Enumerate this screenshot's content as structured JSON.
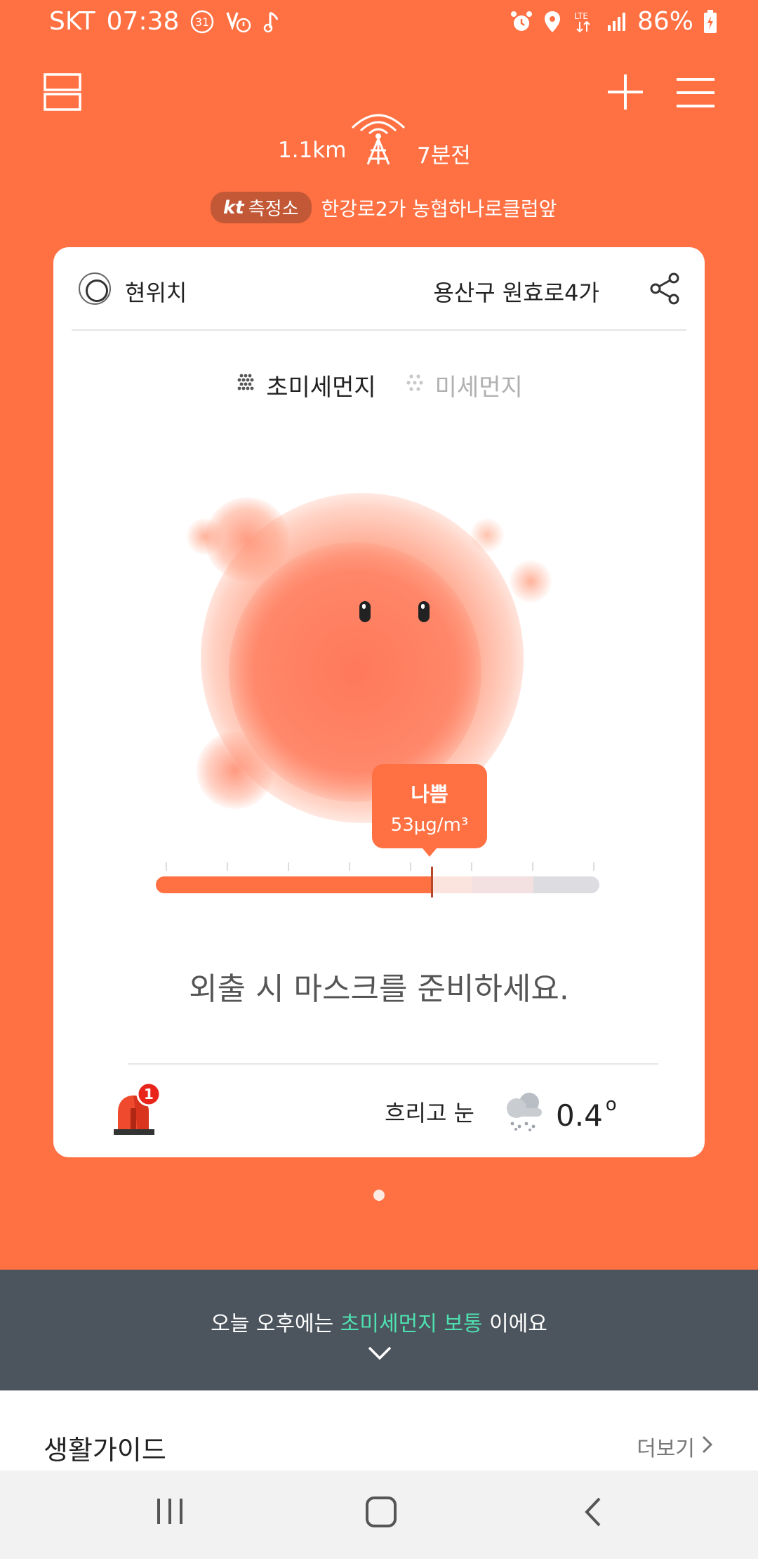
{
  "status_bar": {
    "carrier": "SKT",
    "time": "07:38",
    "calendar_badge": "31",
    "battery": "86%"
  },
  "header": {
    "distance": "1.1km",
    "updated_ago": "7분전",
    "station_badge_logo": "kt",
    "station_badge_label": "측정소",
    "station_name": "한강로2가 농협하나로클럽앞"
  },
  "card": {
    "location_label": "현위치",
    "address": "용산구 원효로4가",
    "tabs": [
      {
        "label": "초미세먼지",
        "active": true
      },
      {
        "label": "미세먼지",
        "active": false
      }
    ],
    "level": {
      "label": "나쁨",
      "value": "53μg/m³",
      "gauge_fraction": 0.62
    },
    "advice": "외출 시 마스크를 준비하세요.",
    "alert_count": "1",
    "weather": {
      "condition": "흐리고 눈",
      "temperature": "0.4",
      "unit": "o"
    }
  },
  "banner": {
    "prefix": "오늘 오후에는 ",
    "highlight": "초미세먼지 보통",
    "suffix": " 이에요"
  },
  "guide": {
    "title": "생활가이드",
    "more": "더보기"
  },
  "colors": {
    "brand_orange": "#FF7043",
    "banner_bg": "#4C545D",
    "banner_highlight": "#4FE0B0"
  }
}
